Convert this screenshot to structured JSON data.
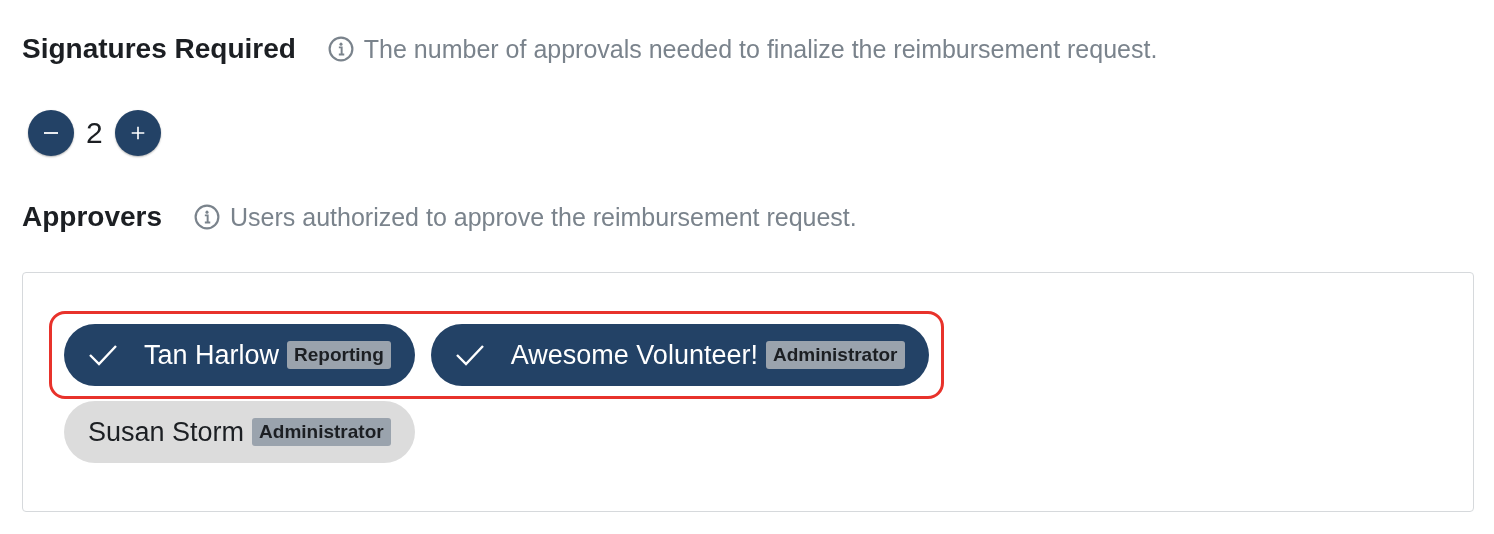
{
  "signatures": {
    "title": "Signatures Required",
    "hint": "The number of approvals needed to finalize the reimbursement request.",
    "value": "2"
  },
  "approvers": {
    "title": "Approvers",
    "hint": "Users authorized to approve the reimbursement request.",
    "users": [
      {
        "name": "Tan Harlow",
        "role": "Reporting",
        "selected": true
      },
      {
        "name": "Awesome Volunteer!",
        "role": "Administrator",
        "selected": true
      },
      {
        "name": "Susan Storm",
        "role": "Administrator",
        "selected": false
      }
    ]
  }
}
